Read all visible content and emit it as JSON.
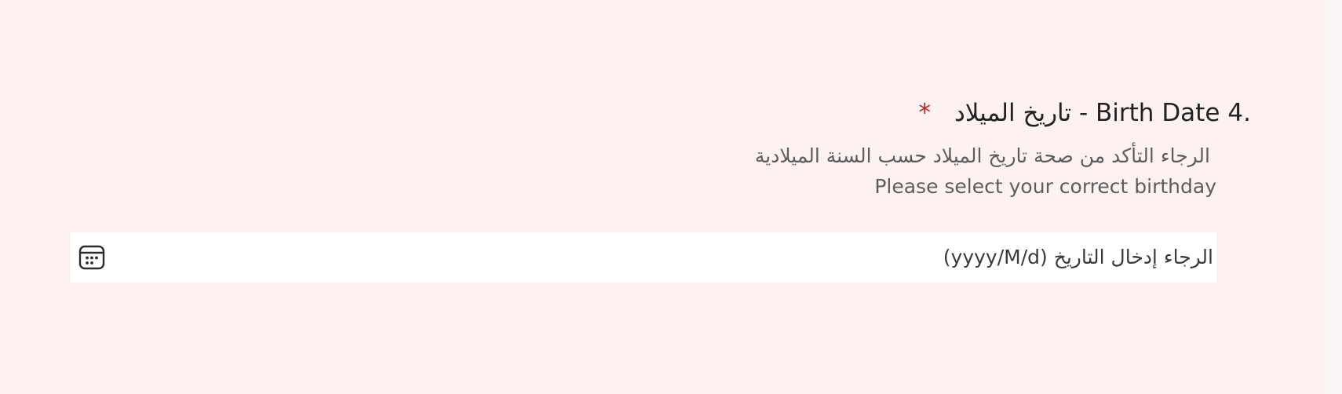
{
  "question": {
    "number": "4.",
    "title": "Birth Date - تاريخ الميلاد",
    "required_mark": "*",
    "description_ar": "الرجاء التأكد من صحة تاريخ الميلاد حسب السنة الميلادية",
    "description_en": "Please select your correct birthday"
  },
  "date_field": {
    "placeholder": "الرجاء إدخال التاريخ (yyyy/M/d)",
    "icon": "calendar-icon"
  },
  "colors": {
    "page_background": "#fdf1f1",
    "input_background": "#ffffff",
    "required": "#b12a2a",
    "title_text": "#222222",
    "description_text": "#5d5d5d"
  }
}
